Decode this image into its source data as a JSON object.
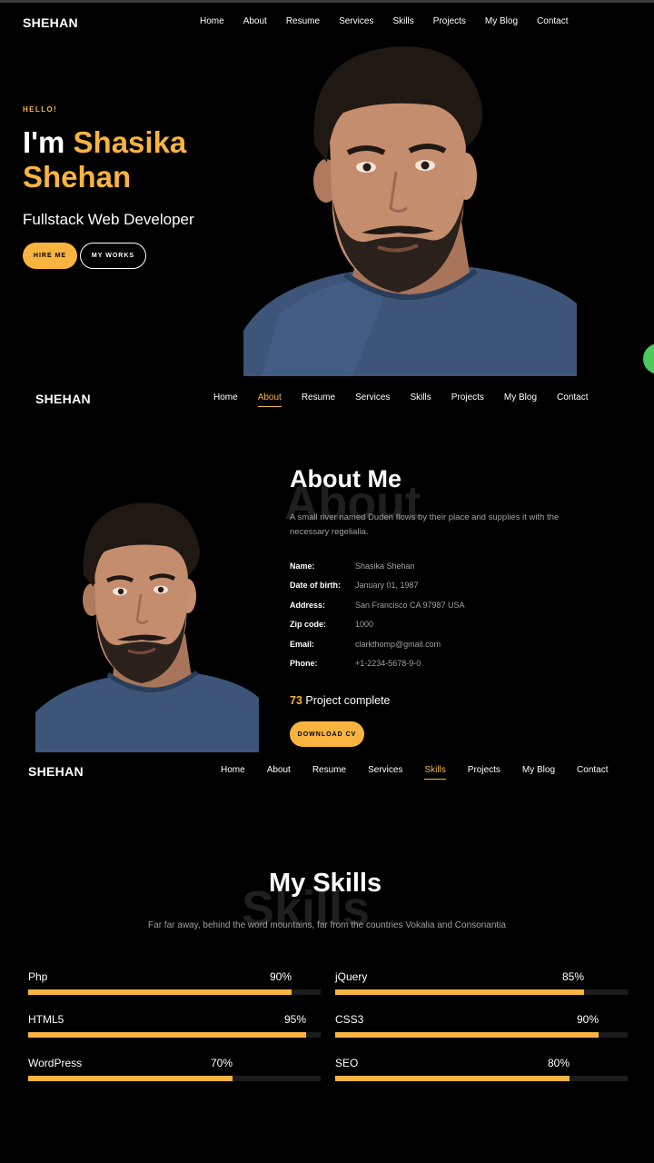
{
  "brand": "SHEHAN",
  "nav_items": [
    "Home",
    "About",
    "Resume",
    "Services",
    "Skills",
    "Projects",
    "My Blog",
    "Contact"
  ],
  "nav_active": {
    "nav1": 0,
    "nav2": 1,
    "nav3": 4
  },
  "hero": {
    "hello": "HELLO!",
    "im": "I'm",
    "first_name": "Shasika",
    "last_name": "Shehan",
    "subtitle": "Fullstack Web Developer",
    "hire_label": "HIRE ME",
    "works_label": "MY WORKS"
  },
  "about": {
    "ghost": "About",
    "title": "About Me",
    "description": "A small river named Duden flows by their place and supplies it with the necessary regelialia.",
    "info": [
      {
        "label": "Name:",
        "value": "Shasika Shehan"
      },
      {
        "label": "Date of birth:",
        "value": "January 01, 1987"
      },
      {
        "label": "Address:",
        "value": "San Francisco CA 97987 USA"
      },
      {
        "label": "Zip code:",
        "value": "1000"
      },
      {
        "label": "Email:",
        "value": "clarkthomp@gmail.com"
      },
      {
        "label": "Phone:",
        "value": "+1-2234-5678-9-0"
      }
    ],
    "project_count": "73",
    "project_label": "Project complete",
    "cv_label": "DOWNLOAD CV"
  },
  "skills": {
    "ghost": "Skills",
    "title": "My Skills",
    "description": "Far far away, behind the word mountains, far from the countries Vokalia and Consonantia",
    "items": [
      {
        "name": "Php",
        "percent": "90%",
        "level": 0.9
      },
      {
        "name": "jQuery",
        "percent": "85%",
        "level": 0.85
      },
      {
        "name": "HTML5",
        "percent": "95%",
        "level": 0.95
      },
      {
        "name": "CSS3",
        "percent": "90%",
        "level": 0.9
      },
      {
        "name": "WordPress",
        "percent": "70%",
        "level": 0.7
      },
      {
        "name": "SEO",
        "percent": "80%",
        "level": 0.8
      }
    ]
  },
  "colors": {
    "accent": "#f9b440",
    "background": "#000000",
    "muted_text": "#a0a0a0",
    "whatsapp": "#4cca5a"
  },
  "icons": {
    "chat_bubble": "whatsapp-icon"
  }
}
